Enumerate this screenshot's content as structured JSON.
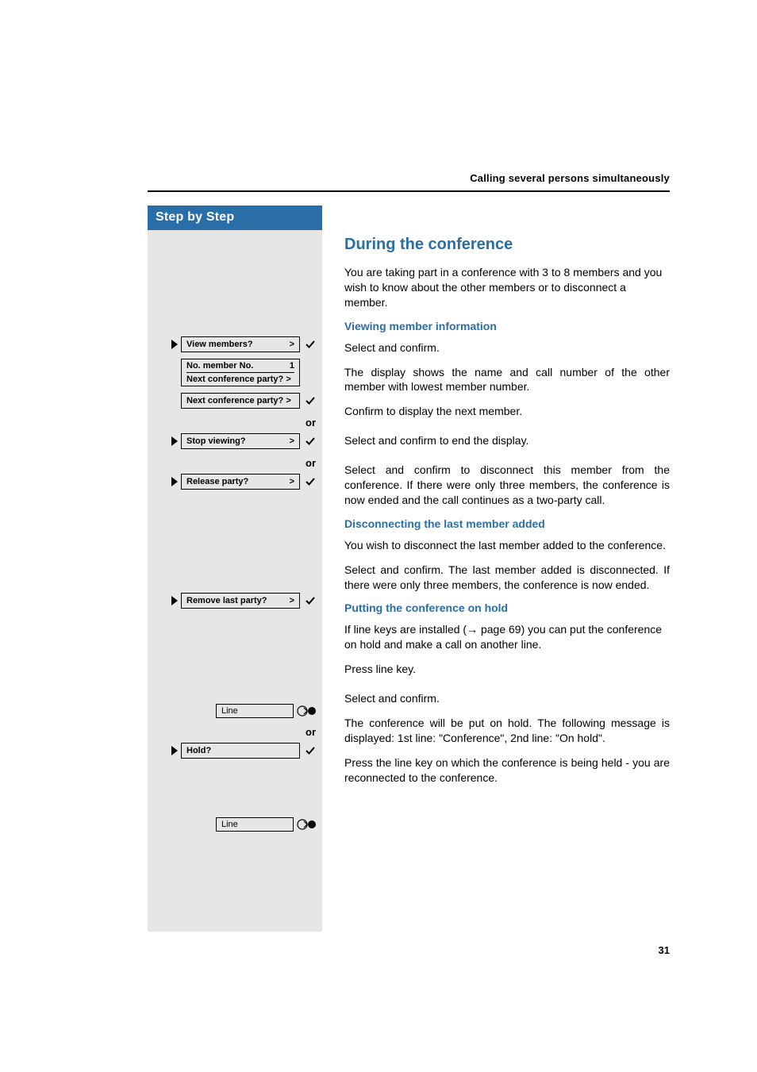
{
  "running_head": "Calling several persons simultaneously",
  "sidebar": {
    "title": "Step by Step",
    "view_members": "View members?",
    "display_line1_label": "No. member No.",
    "display_line1_value": "1",
    "display_line2": "Next conference party? >",
    "next_conf": "Next conference party? >",
    "or": "or",
    "stop_viewing": "Stop viewing?",
    "release_party": "Release party?",
    "remove_last": "Remove last party?",
    "line_key": "Line",
    "hold": "Hold?"
  },
  "content": {
    "h2": "During the conference",
    "intro": "You are taking part in a conference with 3 to 8 members and you wish to know about the other members or to disconnect a member.",
    "h3_view": "Viewing member information",
    "view_select": "Select and confirm.",
    "view_display": "The display shows the name and call number of the other member with lowest member number.",
    "next_confirm": "Confirm to display the next member.",
    "stop_select": "Select and confirm to end the display.",
    "release_select": "Select and confirm to disconnect this member from the conference. If there were only three members, the conference is now ended and the call continues as a two-party call.",
    "h3_disc": "Disconnecting the last member added",
    "disc_intro": "You wish to disconnect the last member added to the conference.",
    "remove_select": "Select and confirm. The last member added is disconnected. If there were only three members, the conference is now ended.",
    "h3_hold": "Putting the conference on hold",
    "hold_intro_a": "If line keys are installed (",
    "hold_intro_b": " page 69) you can put the conference on hold and make a call on another line.",
    "press_line": "Press line key.",
    "hold_select": "Select and confirm.",
    "hold_result": "The conference will be put on hold. The following message is displayed: 1st line: \"Conference\", 2nd line: \"On hold\".",
    "press_line_back": "Press the line key on which the conference is being held - you are reconnected to the conference."
  },
  "page_number": "31"
}
